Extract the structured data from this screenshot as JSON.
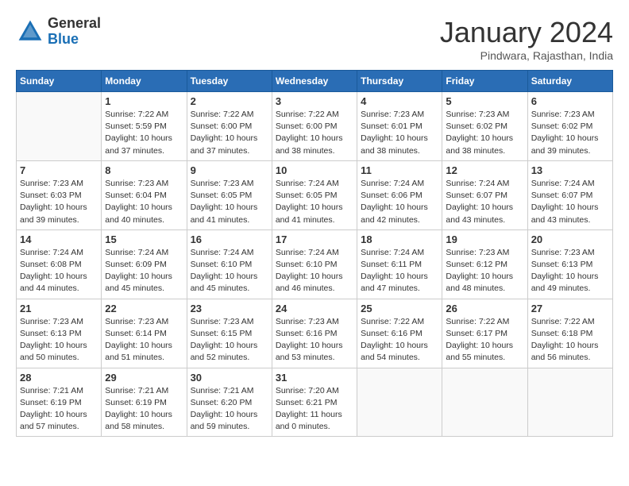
{
  "header": {
    "logo_line1": "General",
    "logo_line2": "Blue",
    "month": "January 2024",
    "location": "Pindwara, Rajasthan, India"
  },
  "weekdays": [
    "Sunday",
    "Monday",
    "Tuesday",
    "Wednesday",
    "Thursday",
    "Friday",
    "Saturday"
  ],
  "weeks": [
    [
      {
        "day": "",
        "info": ""
      },
      {
        "day": "1",
        "info": "Sunrise: 7:22 AM\nSunset: 5:59 PM\nDaylight: 10 hours\nand 37 minutes."
      },
      {
        "day": "2",
        "info": "Sunrise: 7:22 AM\nSunset: 6:00 PM\nDaylight: 10 hours\nand 37 minutes."
      },
      {
        "day": "3",
        "info": "Sunrise: 7:22 AM\nSunset: 6:00 PM\nDaylight: 10 hours\nand 38 minutes."
      },
      {
        "day": "4",
        "info": "Sunrise: 7:23 AM\nSunset: 6:01 PM\nDaylight: 10 hours\nand 38 minutes."
      },
      {
        "day": "5",
        "info": "Sunrise: 7:23 AM\nSunset: 6:02 PM\nDaylight: 10 hours\nand 38 minutes."
      },
      {
        "day": "6",
        "info": "Sunrise: 7:23 AM\nSunset: 6:02 PM\nDaylight: 10 hours\nand 39 minutes."
      }
    ],
    [
      {
        "day": "7",
        "info": "Sunrise: 7:23 AM\nSunset: 6:03 PM\nDaylight: 10 hours\nand 39 minutes."
      },
      {
        "day": "8",
        "info": "Sunrise: 7:23 AM\nSunset: 6:04 PM\nDaylight: 10 hours\nand 40 minutes."
      },
      {
        "day": "9",
        "info": "Sunrise: 7:23 AM\nSunset: 6:05 PM\nDaylight: 10 hours\nand 41 minutes."
      },
      {
        "day": "10",
        "info": "Sunrise: 7:24 AM\nSunset: 6:05 PM\nDaylight: 10 hours\nand 41 minutes."
      },
      {
        "day": "11",
        "info": "Sunrise: 7:24 AM\nSunset: 6:06 PM\nDaylight: 10 hours\nand 42 minutes."
      },
      {
        "day": "12",
        "info": "Sunrise: 7:24 AM\nSunset: 6:07 PM\nDaylight: 10 hours\nand 43 minutes."
      },
      {
        "day": "13",
        "info": "Sunrise: 7:24 AM\nSunset: 6:07 PM\nDaylight: 10 hours\nand 43 minutes."
      }
    ],
    [
      {
        "day": "14",
        "info": "Sunrise: 7:24 AM\nSunset: 6:08 PM\nDaylight: 10 hours\nand 44 minutes."
      },
      {
        "day": "15",
        "info": "Sunrise: 7:24 AM\nSunset: 6:09 PM\nDaylight: 10 hours\nand 45 minutes."
      },
      {
        "day": "16",
        "info": "Sunrise: 7:24 AM\nSunset: 6:10 PM\nDaylight: 10 hours\nand 45 minutes."
      },
      {
        "day": "17",
        "info": "Sunrise: 7:24 AM\nSunset: 6:10 PM\nDaylight: 10 hours\nand 46 minutes."
      },
      {
        "day": "18",
        "info": "Sunrise: 7:24 AM\nSunset: 6:11 PM\nDaylight: 10 hours\nand 47 minutes."
      },
      {
        "day": "19",
        "info": "Sunrise: 7:23 AM\nSunset: 6:12 PM\nDaylight: 10 hours\nand 48 minutes."
      },
      {
        "day": "20",
        "info": "Sunrise: 7:23 AM\nSunset: 6:13 PM\nDaylight: 10 hours\nand 49 minutes."
      }
    ],
    [
      {
        "day": "21",
        "info": "Sunrise: 7:23 AM\nSunset: 6:13 PM\nDaylight: 10 hours\nand 50 minutes."
      },
      {
        "day": "22",
        "info": "Sunrise: 7:23 AM\nSunset: 6:14 PM\nDaylight: 10 hours\nand 51 minutes."
      },
      {
        "day": "23",
        "info": "Sunrise: 7:23 AM\nSunset: 6:15 PM\nDaylight: 10 hours\nand 52 minutes."
      },
      {
        "day": "24",
        "info": "Sunrise: 7:23 AM\nSunset: 6:16 PM\nDaylight: 10 hours\nand 53 minutes."
      },
      {
        "day": "25",
        "info": "Sunrise: 7:22 AM\nSunset: 6:16 PM\nDaylight: 10 hours\nand 54 minutes."
      },
      {
        "day": "26",
        "info": "Sunrise: 7:22 AM\nSunset: 6:17 PM\nDaylight: 10 hours\nand 55 minutes."
      },
      {
        "day": "27",
        "info": "Sunrise: 7:22 AM\nSunset: 6:18 PM\nDaylight: 10 hours\nand 56 minutes."
      }
    ],
    [
      {
        "day": "28",
        "info": "Sunrise: 7:21 AM\nSunset: 6:19 PM\nDaylight: 10 hours\nand 57 minutes."
      },
      {
        "day": "29",
        "info": "Sunrise: 7:21 AM\nSunset: 6:19 PM\nDaylight: 10 hours\nand 58 minutes."
      },
      {
        "day": "30",
        "info": "Sunrise: 7:21 AM\nSunset: 6:20 PM\nDaylight: 10 hours\nand 59 minutes."
      },
      {
        "day": "31",
        "info": "Sunrise: 7:20 AM\nSunset: 6:21 PM\nDaylight: 11 hours\nand 0 minutes."
      },
      {
        "day": "",
        "info": ""
      },
      {
        "day": "",
        "info": ""
      },
      {
        "day": "",
        "info": ""
      }
    ]
  ]
}
